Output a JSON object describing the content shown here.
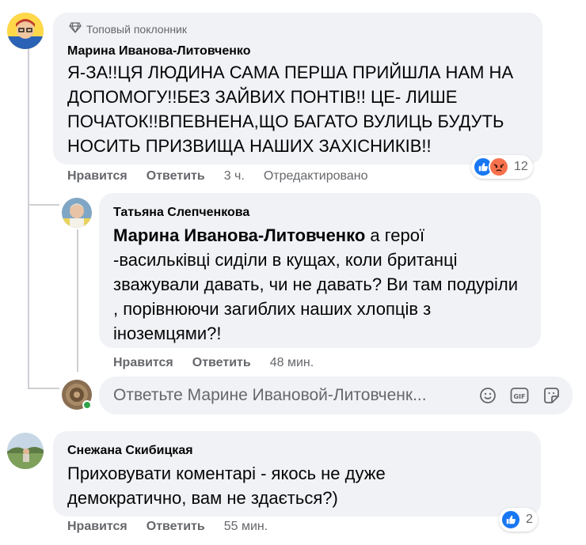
{
  "comment1": {
    "badge": "Топовый поклонник",
    "author": "Марина Иванова-Литовченко",
    "text_lines": [
      "Я-ЗА!!ЦЯ ЛЮДИНА САМА ПЕРША ПРИЙШЛА НАМ НА",
      "ДОПОМОГУ!!БЕЗ ЗАЙВИХ ПОНТІВ!! ЦЕ- ЛИШЕ",
      "ПОЧАТОК!!ВПЕВНЕНА,ЩО БАГАТО ВУЛИЦЬ БУДУТЬ",
      "НОСИТЬ ПРИЗВИЩА НАШИХ ЗАХІСНИКІВ!!"
    ],
    "like_label": "Нравится",
    "reply_label": "Ответить",
    "time": "3 ч.",
    "edited": "Отредактировано",
    "reaction_count": "12"
  },
  "reply1": {
    "author": "Татьяна Слепченкова",
    "mention": "Марина Иванова-Литовченко",
    "text_first": " а герої",
    "text_lines": [
      "-васильківці сиділи в кущах, коли британці",
      "зважували давать, чи не давать? Ви там подуріли",
      ", порівнюючи загиблих наших хлопців з",
      "іноземцями?!"
    ],
    "like_label": "Нравится",
    "reply_label": "Ответить",
    "time": "48 мин."
  },
  "reply_box": {
    "placeholder": "Ответьте Марине Ивановой-Литовченк..."
  },
  "comment2": {
    "author": "Снежана Скибицкая",
    "text_lines": [
      "Приховувати коментарі - якось не дуже",
      "демократично, вам не здається?)"
    ],
    "like_label": "Нравится",
    "reply_label": "Ответить",
    "time": "55 мин.",
    "reaction_count": "2"
  },
  "colors": {
    "like_blue": "#1877f2",
    "angry_orange": "#f7714c",
    "online_green": "#31a24c",
    "bubble_gray": "#f0f2f5"
  },
  "icons": [
    "diamond-icon",
    "like-reaction-icon",
    "angry-reaction-icon",
    "emoji-icon",
    "gif-icon",
    "sticker-icon"
  ]
}
